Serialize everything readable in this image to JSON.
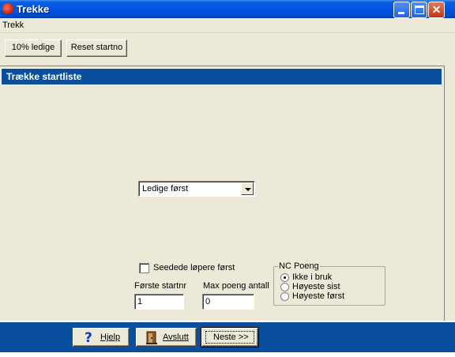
{
  "window": {
    "title": "Trekke"
  },
  "menu": {
    "items": [
      "Trekk"
    ]
  },
  "toolbar": {
    "ledige_label": "10% ledige",
    "reset_label": "Reset startno"
  },
  "panel": {
    "header": "Trække startliste"
  },
  "order_select": {
    "value": "Ledige først"
  },
  "seeded_checkbox": {
    "label": "Seedede løpere først",
    "checked": false
  },
  "first_start": {
    "label": "Første startnr",
    "value": "1"
  },
  "max_points": {
    "label": "Max poeng antall",
    "value": "0"
  },
  "nc_points": {
    "legend": "NC Poeng",
    "options": [
      {
        "label": "Ikke i bruk",
        "checked": true
      },
      {
        "label": "Høyeste sist",
        "checked": false
      },
      {
        "label": "Høyeste først",
        "checked": false
      }
    ]
  },
  "footer": {
    "help_label": "Hjelp",
    "exit_label": "Avslutt",
    "next_label": "Neste >>"
  },
  "colors": {
    "header_blue": "#0a4f9e",
    "title_blue": "#0054e3",
    "face": "#ece9d8"
  }
}
